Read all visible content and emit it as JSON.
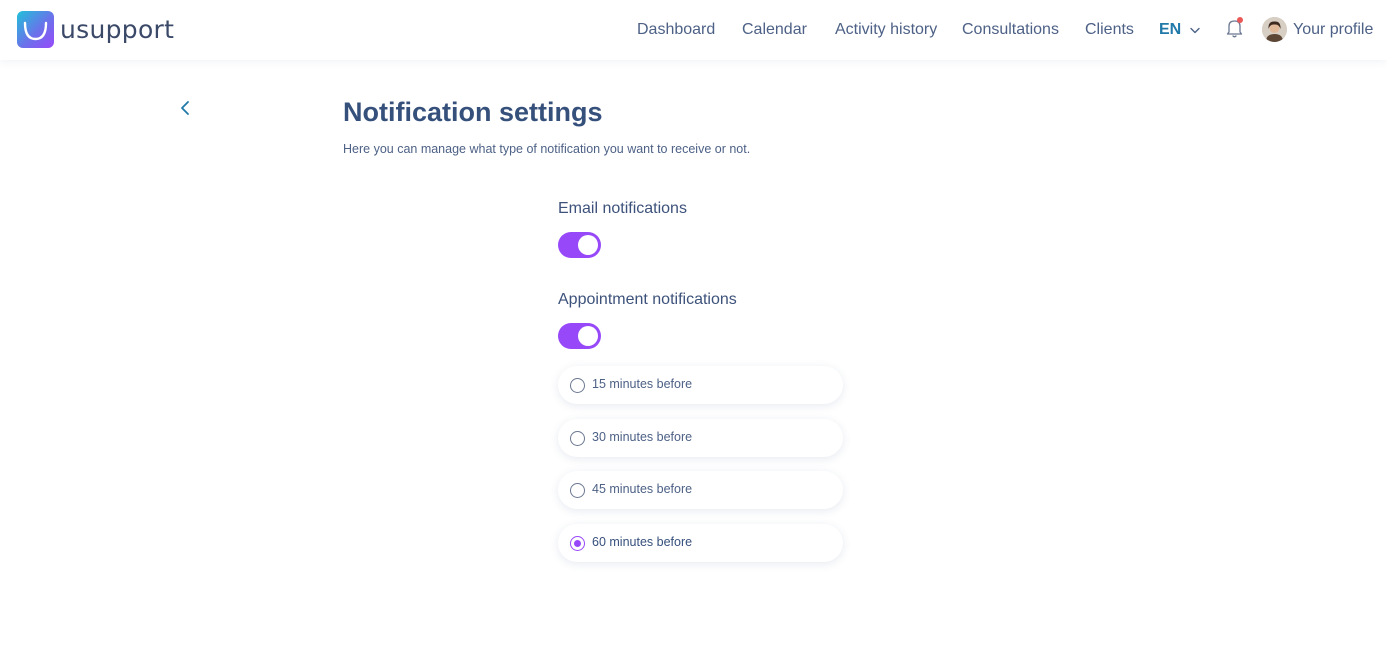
{
  "brand": {
    "name": "usupport"
  },
  "nav": {
    "links": [
      {
        "label": "Dashboard"
      },
      {
        "label": "Calendar"
      },
      {
        "label": "Activity history"
      },
      {
        "label": "Consultations"
      },
      {
        "label": "Clients"
      }
    ],
    "language": "EN",
    "profile_label": "Your profile",
    "has_unread_notifications": true
  },
  "page": {
    "title": "Notification settings",
    "subtitle": "Here you can manage what type of notification you want to receive or not."
  },
  "settings": {
    "email": {
      "label": "Email notifications",
      "enabled": true
    },
    "appointment": {
      "label": "Appointment notifications",
      "enabled": true,
      "options": [
        {
          "label": "15 minutes before",
          "selected": false
        },
        {
          "label": "30 minutes before",
          "selected": false
        },
        {
          "label": "45 minutes before",
          "selected": false
        },
        {
          "label": "60 minutes before",
          "selected": true
        }
      ]
    }
  },
  "colors": {
    "accent": "#9749fa",
    "nav_text": "#4d6186",
    "title": "#36507c",
    "language": "#2079a8",
    "notification_dot": "#eb5757"
  },
  "icons": [
    "logo-icon",
    "chevron-down-icon",
    "bell-icon",
    "back-chevron-icon",
    "radio-icon"
  ]
}
